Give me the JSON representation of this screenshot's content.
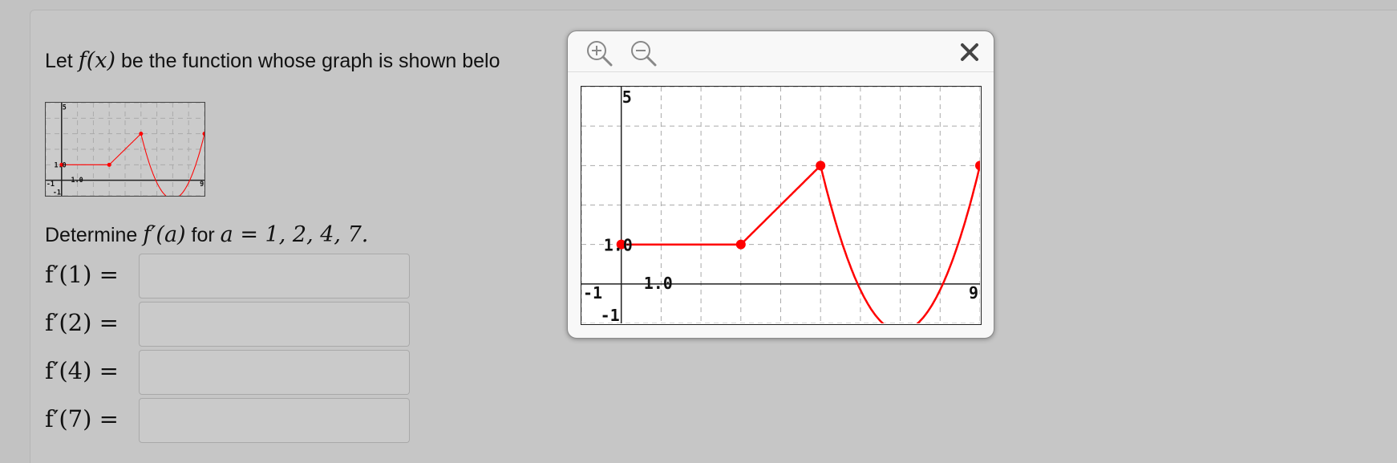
{
  "question": {
    "intro_prefix": "Let",
    "intro_func": "f(x)",
    "intro_suffix": "be the function whose graph is shown belo",
    "determine_prefix": "Determine",
    "determine_func": "f′(a)",
    "determine_for": "for",
    "determine_cond": "a = 1, 2, 4, 7."
  },
  "answers": [
    {
      "label": "f′(1) =",
      "value": ""
    },
    {
      "label": "f′(2) =",
      "value": ""
    },
    {
      "label": "f′(4) =",
      "value": ""
    },
    {
      "label": "f′(7) =",
      "value": ""
    }
  ],
  "graph": {
    "tick_labels": {
      "y_top": "5",
      "y_mid": "1.0",
      "y_bottom": "-1",
      "x_left": "-1",
      "x_mid": "1.0",
      "x_right": "9"
    },
    "curve_color": "#ff0000",
    "points": [
      [
        0,
        1
      ],
      [
        3,
        1
      ],
      [
        5,
        3
      ],
      [
        9,
        3
      ]
    ],
    "x_range": [
      -1,
      9
    ],
    "y_range": [
      -1,
      5
    ]
  },
  "popup": {
    "zoom_in_icon": "zoom-in-icon",
    "zoom_out_icon": "zoom-out-icon",
    "close_icon": "close-icon"
  }
}
